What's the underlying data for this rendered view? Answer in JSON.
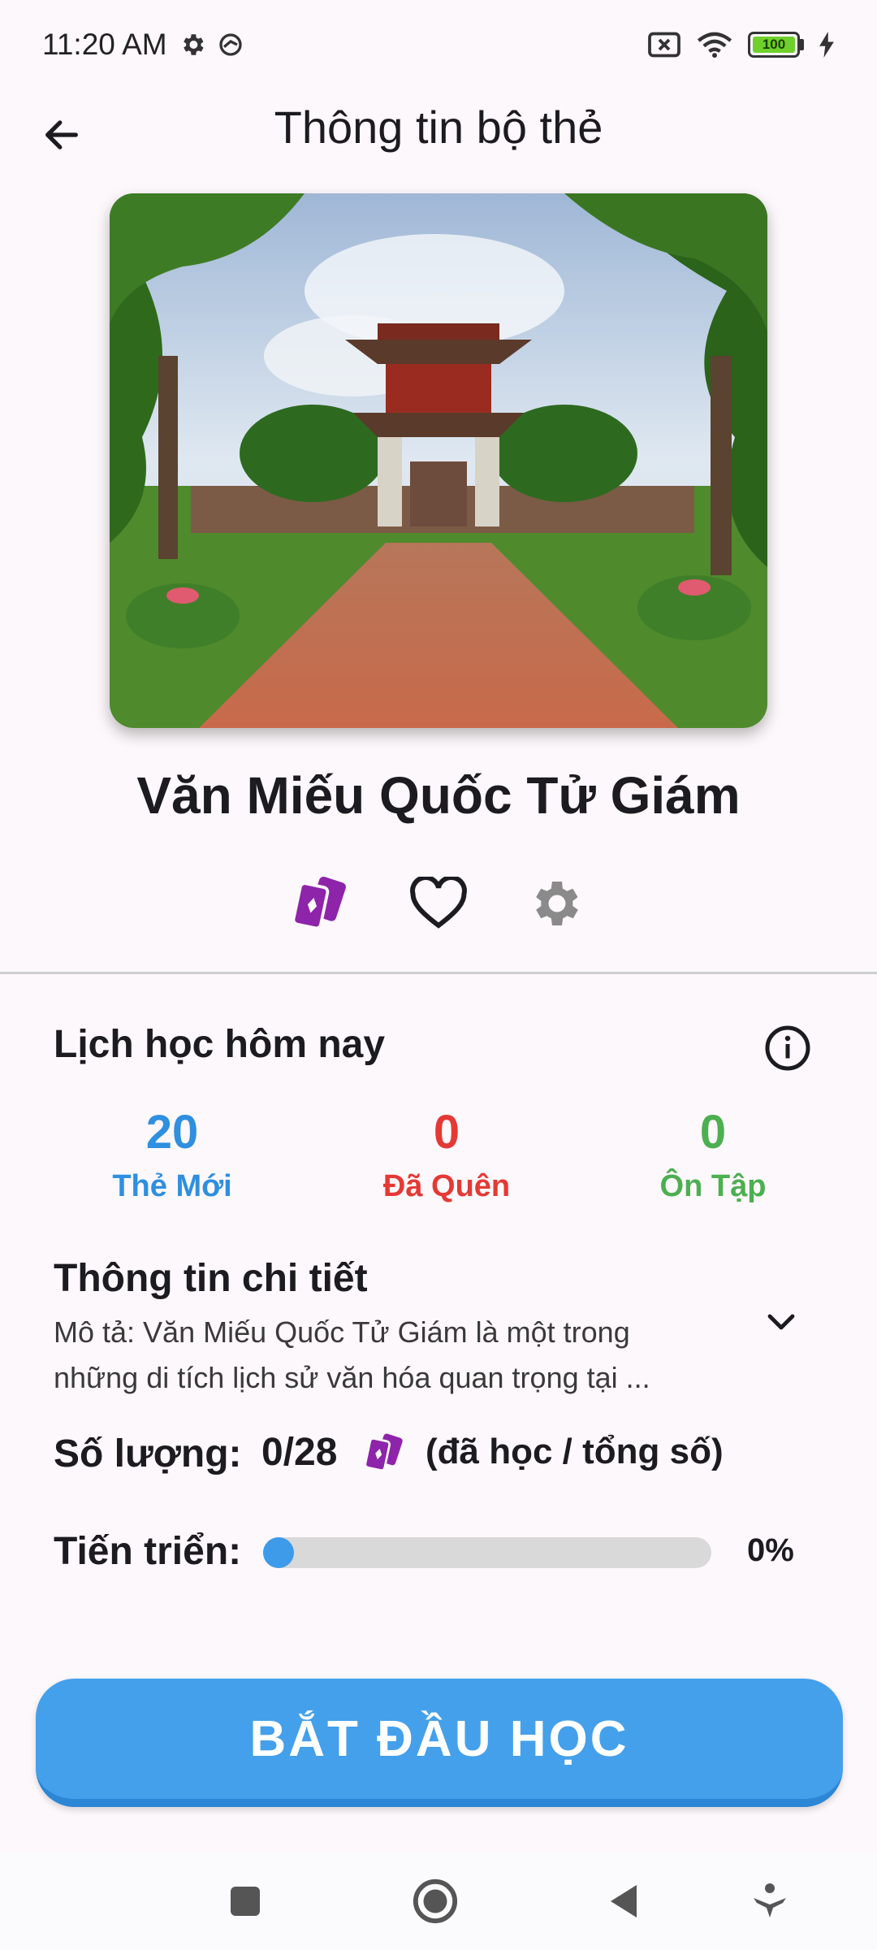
{
  "status_bar": {
    "time": "11:20 AM",
    "battery_level": "100"
  },
  "header": {
    "title": "Thông tin bộ thẻ",
    "back_icon": "arrow-left-icon"
  },
  "deck": {
    "cover_image": "Temple of Literature gate and brick path photo",
    "title": "Văn Miếu Quốc Tử Giám",
    "action_icons": [
      "cards-icon",
      "heart-icon",
      "gear-icon"
    ]
  },
  "today_schedule": {
    "title": "Lịch học hôm nay",
    "stats": [
      {
        "value": "20",
        "label": "Thẻ Mới",
        "color": "#2f8fe0"
      },
      {
        "value": "0",
        "label": "Đã Quên",
        "color": "#e53935"
      },
      {
        "value": "0",
        "label": "Ôn Tập",
        "color": "#4caf50"
      }
    ]
  },
  "details": {
    "title": "Thông tin chi tiết",
    "description_line1": "Mô tả:  Văn Miếu Quốc Tử Giám là một trong",
    "description_line2": "những di tích lịch sử văn hóa quan trọng tại ...",
    "quantity_label": "Số lượng:",
    "quantity_value": "0/28",
    "quantity_note": "(đã học / tổng số)",
    "progress_label": "Tiến triển:",
    "progress_percent": "0%",
    "progress_value": 0
  },
  "start_button": {
    "label": "BẮT ĐẦU HỌC"
  },
  "colors": {
    "accent_purple": "#8e24aa",
    "primary_blue": "#44a0ea"
  }
}
